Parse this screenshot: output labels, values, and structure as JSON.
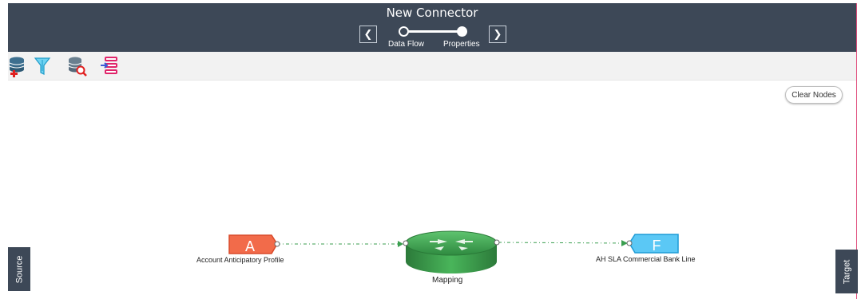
{
  "header": {
    "title": "New Connector",
    "prev_icon": "chevron-left-icon",
    "next_icon": "chevron-right-icon",
    "prev_glyph": "❮",
    "next_glyph": "❯",
    "steps": [
      {
        "label": "Data Flow"
      },
      {
        "label": "Properties"
      }
    ],
    "bg_color": "#3d4857"
  },
  "toolbar": {
    "tools": [
      {
        "icon": "add-datastore-icon"
      },
      {
        "icon": "filter-icon"
      },
      {
        "icon": "search-datastore-icon"
      },
      {
        "icon": "list-import-icon"
      }
    ]
  },
  "canvas": {
    "clear_label": "Clear Nodes",
    "source_label": "Source",
    "target_label": "Target"
  },
  "flow": {
    "source_node": {
      "letter": "A",
      "label": "Account Anticipatory Profile",
      "color": "#f26b4a"
    },
    "mapping_node": {
      "label": "Mapping",
      "color": "#3f9e4f",
      "icon": "router-arrows-icon"
    },
    "target_node": {
      "letter": "F",
      "label": "AH SLA Commercial Bank Line",
      "color": "#5bc8f5"
    },
    "edge_color": "#3a9e4f"
  }
}
